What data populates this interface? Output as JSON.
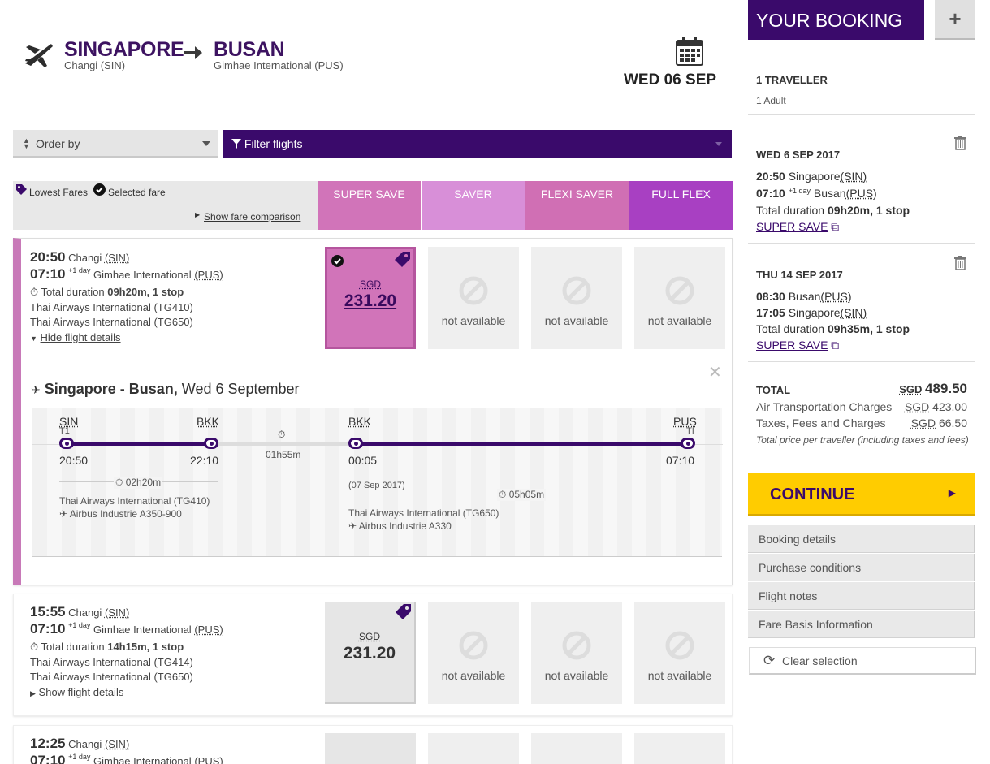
{
  "route": {
    "origin_city": "SINGAPORE",
    "origin_airport": "Changi (SIN)",
    "destination_city": "BUSAN",
    "destination_airport": "Gimhae International (PUS)",
    "date": "WED 06 SEP"
  },
  "toolbar": {
    "order_by": "Order by",
    "filter": "Filter flights"
  },
  "fare_legend": {
    "lowest": "Lowest Fares",
    "selected": "Selected fare",
    "show_comparison": "Show fare comparison"
  },
  "fare_columns": [
    {
      "label": "SUPER SAVE",
      "color": "#d174b9"
    },
    {
      "label": "SAVER",
      "color": "#d88fd8"
    },
    {
      "label": "FLEXI SAVER",
      "color": "#d06fb4"
    },
    {
      "label": "FULL FLEX",
      "color": "#a840c2"
    }
  ],
  "flights": [
    {
      "dep_time": "20:50",
      "dep_airport": "Changi",
      "dep_code": "(SIN)",
      "arr_time": "07:10",
      "arr_plus": "+1 day",
      "arr_airport": "Gimhae International",
      "arr_code": "(PUS)",
      "duration_label": "Total duration",
      "duration": "09h20m, 1 stop",
      "leg1": "Thai Airways International (TG410)",
      "leg2": "Thai Airways International (TG650)",
      "details_toggle": "Hide flight details",
      "currency": "SGD",
      "price": "231.20",
      "not_available": "not available"
    },
    {
      "dep_time": "15:55",
      "dep_airport": "Changi",
      "dep_code": "(SIN)",
      "arr_time": "07:10",
      "arr_plus": "+1 day",
      "arr_airport": "Gimhae International",
      "arr_code": "(PUS)",
      "duration_label": "Total duration",
      "duration": "14h15m, 1 stop",
      "leg1": "Thai Airways International (TG414)",
      "leg2": "Thai Airways International (TG650)",
      "details_toggle": "Show flight details",
      "currency": "SGD",
      "price": "231.20",
      "not_available": "not available"
    },
    {
      "dep_time": "12:25",
      "dep_airport": "Changi",
      "dep_code": "(SIN)",
      "arr_time": "07:10",
      "arr_plus": "+1 day",
      "arr_airport": "Gimhae International",
      "arr_code": "(PUS)"
    }
  ],
  "details": {
    "title_route": "Singapore - Busan,",
    "title_date": "Wed 6 September",
    "seg1": {
      "from_code": "SIN",
      "from_terminal": "T1",
      "from_time": "20:50",
      "to_code": "BKK",
      "to_time": "22:10",
      "duration": "02h20m",
      "carrier": "Thai Airways International (TG410)",
      "aircraft": "Airbus Industrie A350-900"
    },
    "layover": "01h55m",
    "seg2": {
      "from_code": "BKK",
      "from_time": "00:05",
      "from_date": "(07 Sep 2017)",
      "to_code": "PUS",
      "to_terminal": "TI",
      "to_time": "07:10",
      "duration": "05h05m",
      "carrier": "Thai Airways International (TG650)",
      "aircraft": "Airbus Industrie A330"
    }
  },
  "booking": {
    "title": "YOUR BOOKING",
    "plus": "+",
    "travellers": "1 TRAVELLER",
    "traveller_type": "1 Adult",
    "out": {
      "date": "WED 6 SEP 2017",
      "dep_time": "20:50",
      "dep_city": "Singapore",
      "dep_code": "(SIN)",
      "arr_time": "07:10",
      "arr_plus": "+1 day",
      "arr_city": "Busan",
      "arr_code": "(PUS)",
      "duration_label": "Total duration",
      "duration": "09h20m, 1 stop",
      "fare": "SUPER SAVE"
    },
    "ret": {
      "date": "THU 14 SEP 2017",
      "dep_time": "08:30",
      "dep_city": "Busan",
      "dep_code": "(PUS)",
      "arr_time": "17:05",
      "arr_city": "Singapore",
      "arr_code": "(SIN)",
      "duration_label": "Total duration",
      "duration": "09h35m, 1 stop",
      "fare": "SUPER SAVE"
    },
    "total_label": "TOTAL",
    "total_currency": "SGD",
    "total": "489.50",
    "air_label": "Air Transportation Charges",
    "air_currency": "SGD",
    "air": "423.00",
    "tax_label": "Taxes, Fees and Charges",
    "tax_currency": "SGD",
    "tax": "66.50",
    "note": "Total price per traveller (including taxes and fees)",
    "continue": "CONTINUE",
    "menu": [
      "Booking details",
      "Purchase conditions",
      "Flight notes",
      "Fare Basis Information"
    ],
    "clear": "Clear selection"
  }
}
